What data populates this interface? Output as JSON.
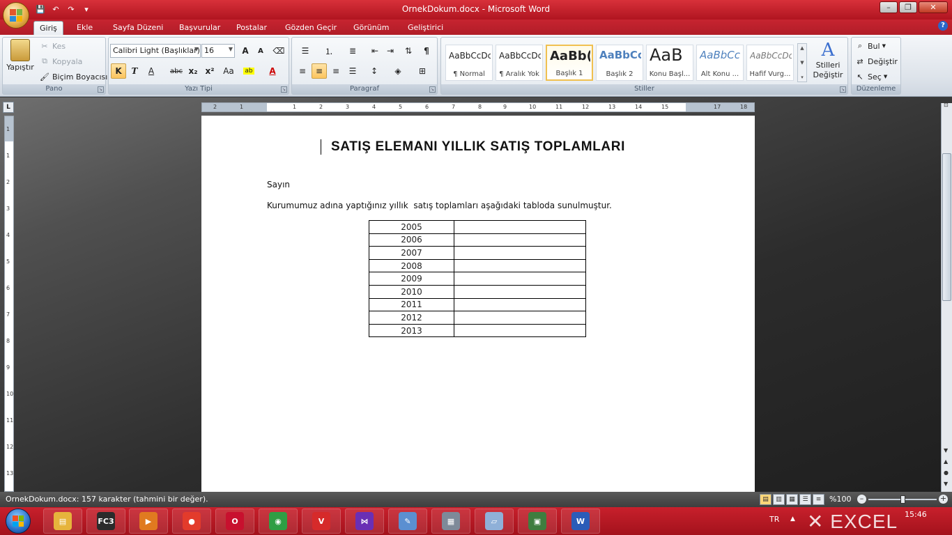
{
  "window": {
    "title": "OrnekDokum.docx - Microsoft Word",
    "min": "–",
    "max": "❐",
    "close": "✕"
  },
  "tabs": [
    {
      "label": "Giriş"
    },
    {
      "label": "Ekle"
    },
    {
      "label": "Sayfa Düzeni"
    },
    {
      "label": "Başvurular"
    },
    {
      "label": "Postalar"
    },
    {
      "label": "Gözden Geçir"
    },
    {
      "label": "Görünüm"
    },
    {
      "label": "Geliştirici"
    }
  ],
  "help": "?",
  "ribbon": {
    "clipboard": {
      "label": "Pano",
      "paste": "Yapıştır",
      "cut": "Kes",
      "copy": "Kopyala",
      "format_painter": "Biçim Boyacısı"
    },
    "font": {
      "label": "Yazı Tipi",
      "font_name": "Calibri Light (Başlıklar)",
      "font_size": "16",
      "grow": "A",
      "shrink": "A",
      "bold": "K",
      "italic": "T",
      "underline": "A",
      "strike": "abc",
      "subscript": "x₂",
      "superscript": "x²",
      "case": "Aa"
    },
    "paragraph": {
      "label": "Paragraf",
      "pilcrow": "¶"
    },
    "styles": {
      "label": "Stiller",
      "items": [
        {
          "sample": "AaBbCcDc",
          "name": "¶ Normal"
        },
        {
          "sample": "AaBbCcDc",
          "name": "¶ Aralık Yok"
        },
        {
          "sample": "AaBb(",
          "name": "Başlık 1"
        },
        {
          "sample": "AaBbCc",
          "name": "Başlık 2"
        },
        {
          "sample": "AaB",
          "name": "Konu Başl..."
        },
        {
          "sample": "AaBbCc",
          "name": "Alt Konu ..."
        },
        {
          "sample": "AaBbCcDc",
          "name": "Hafif Vurg..."
        }
      ],
      "change_styles_line1": "Stilleri",
      "change_styles_line2": "Değiştir"
    },
    "editing": {
      "label": "Düzenleme",
      "find": "Bul",
      "replace": "Değiştir",
      "select": "Seç"
    }
  },
  "ruler": {
    "corner": "L",
    "numbers": [
      "2",
      "1",
      "1",
      "2",
      "3",
      "4",
      "5",
      "6",
      "7",
      "8",
      "9",
      "10",
      "11",
      "12",
      "13",
      "14",
      "15",
      "17",
      "18"
    ],
    "vnumbers": [
      "1",
      "1",
      "2",
      "3",
      "4",
      "5",
      "6",
      "7",
      "8",
      "9",
      "10",
      "11",
      "12",
      "13"
    ]
  },
  "document": {
    "title": "SATIŞ ELEMANI YILLIK SATIŞ TOPLAMLARI",
    "salutation": "Sayın",
    "body": "Kurumumuz adına yaptığınız yıllık  satış toplamları aşağıdaki tabloda sunulmuştur.",
    "table_rows": [
      {
        "year": "2005",
        "value": ""
      },
      {
        "year": "2006",
        "value": ""
      },
      {
        "year": "2007",
        "value": ""
      },
      {
        "year": "2008",
        "value": ""
      },
      {
        "year": "2009",
        "value": ""
      },
      {
        "year": "2010",
        "value": ""
      },
      {
        "year": "2011",
        "value": ""
      },
      {
        "year": "2012",
        "value": ""
      },
      {
        "year": "2013",
        "value": ""
      }
    ]
  },
  "status": {
    "text": "OrnekDokum.docx: 157 karakter (tahmini bir değer).",
    "zoom": "%100",
    "zoom_fraction": 0.5,
    "zoom_minus": "–",
    "zoom_plus": "+"
  },
  "taskbar": {
    "apps": [
      {
        "name": "file-explorer",
        "color": "#e6b43c",
        "glyph": "▤"
      },
      {
        "name": "fc3",
        "color": "#2b2b2b",
        "glyph": "FC3"
      },
      {
        "name": "media-player",
        "color": "#e07a20",
        "glyph": "▶"
      },
      {
        "name": "app-red",
        "color": "#e33b2b",
        "glyph": "●"
      },
      {
        "name": "opera",
        "color": "#c8102e",
        "glyph": "O"
      },
      {
        "name": "chrome",
        "color": "#2f9e44",
        "glyph": "◉"
      },
      {
        "name": "vivaldi",
        "color": "#d62a2a",
        "glyph": "V"
      },
      {
        "name": "visual-studio",
        "color": "#6a2fb5",
        "glyph": "⋈"
      },
      {
        "name": "paint",
        "color": "#5b8fd1",
        "glyph": "✎"
      },
      {
        "name": "calculator",
        "color": "#7e8a99",
        "glyph": "▦"
      },
      {
        "name": "notes",
        "color": "#8fb0d8",
        "glyph": "▱"
      },
      {
        "name": "remote-desktop",
        "color": "#3f7d3f",
        "glyph": "▣"
      },
      {
        "name": "word",
        "color": "#2b5cb8",
        "glyph": "W"
      }
    ],
    "lang": "TR",
    "tray_arrow": "▲",
    "clock": "15:46"
  }
}
